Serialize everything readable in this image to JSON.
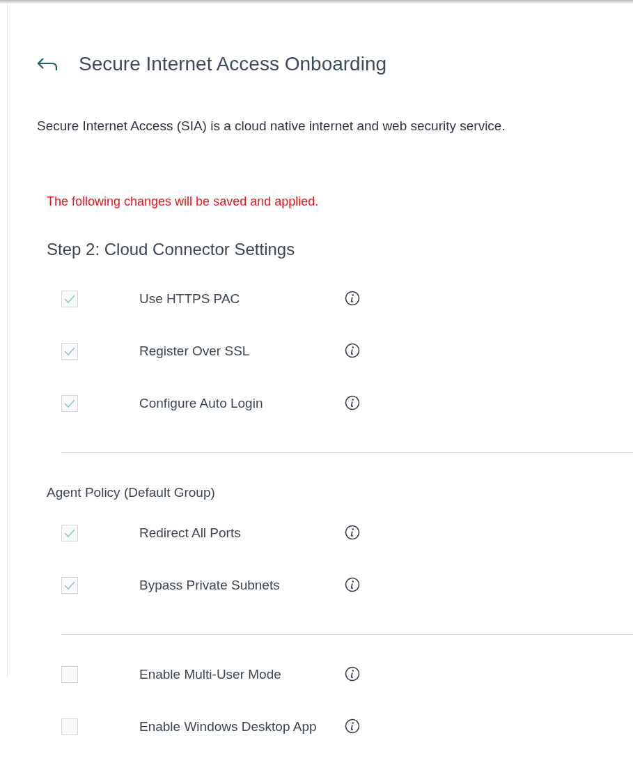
{
  "header": {
    "title": "Secure Internet Access Onboarding"
  },
  "description": "Secure Internet Access (SIA) is a cloud native internet and web security service.",
  "notice": "The following changes will be saved and applied.",
  "step_title": "Step 2: Cloud Connector Settings",
  "groups": [
    {
      "options": [
        {
          "label": "Use HTTPS PAC",
          "checked": true
        },
        {
          "label": "Register Over SSL",
          "checked": true
        },
        {
          "label": "Configure Auto Login",
          "checked": true
        }
      ]
    },
    {
      "heading": "Agent Policy (Default Group)",
      "options": [
        {
          "label": "Redirect All Ports",
          "checked": true
        },
        {
          "label": "Bypass Private Subnets",
          "checked": true
        }
      ]
    },
    {
      "options": [
        {
          "label": "Enable Multi-User Mode",
          "checked": false
        },
        {
          "label": "Enable Windows Desktop App",
          "checked": false
        }
      ]
    }
  ]
}
